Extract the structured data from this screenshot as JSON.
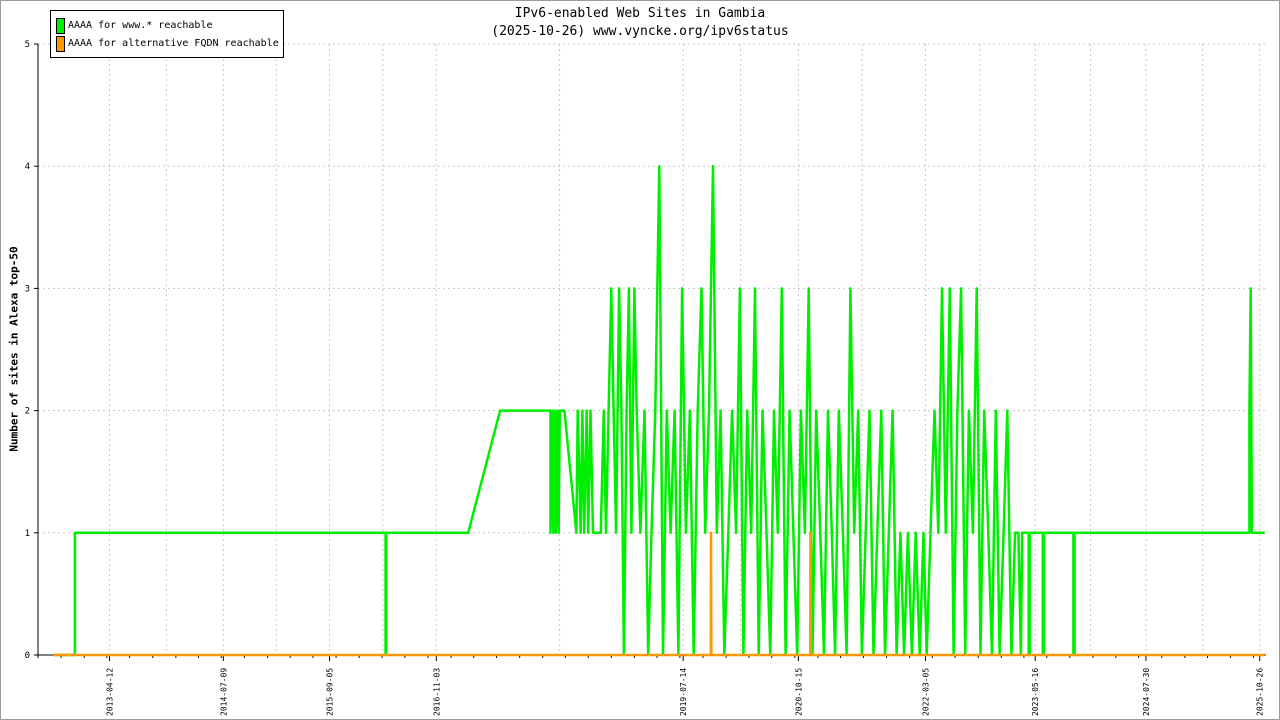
{
  "chart_data": {
    "type": "line",
    "title": "IPv6-enabled Web Sites in Gambia",
    "subtitle": "(2025-10-26) www.vyncke.org/ipv6status",
    "ylabel": "Number of sites in Alexa top-50",
    "xlabel": "",
    "ylim": [
      0,
      5
    ],
    "xlim": [
      "2012-07-01",
      "2025-11-20"
    ],
    "y_ticks": [
      0,
      1,
      2,
      3,
      4,
      5
    ],
    "x_ticks": [
      "2013-04-12",
      "2014-07-09",
      "2015-09-05",
      "2016-11-03",
      "2019-07-14",
      "2020-10-15",
      "2022-03-05",
      "2023-05-16",
      "2024-07-30",
      "2025-10-26"
    ],
    "grid": true,
    "legend_position": "top-left",
    "series": [
      {
        "name": "AAAA for www.* reachable",
        "color": "#00ee00",
        "points": [
          [
            "2012-08-30",
            0
          ],
          [
            "2012-11-25",
            0
          ],
          [
            "2012-11-25",
            1
          ],
          [
            "2016-04-15",
            1
          ],
          [
            "2016-04-15",
            0
          ],
          [
            "2016-04-18",
            0
          ],
          [
            "2016-04-18",
            1
          ],
          [
            "2017-03-10",
            1
          ],
          [
            "2017-07-15",
            2
          ],
          [
            "2018-02-01",
            2
          ],
          [
            "2018-02-01",
            1
          ],
          [
            "2018-02-10",
            2
          ],
          [
            "2018-02-12",
            1
          ],
          [
            "2018-02-18",
            2
          ],
          [
            "2018-02-22",
            1
          ],
          [
            "2018-02-28",
            2
          ],
          [
            "2018-03-05",
            1
          ],
          [
            "2018-03-10",
            2
          ],
          [
            "2018-03-28",
            2
          ],
          [
            "2018-05-15",
            1
          ],
          [
            "2018-05-20",
            2
          ],
          [
            "2018-06-01",
            1
          ],
          [
            "2018-06-08",
            2
          ],
          [
            "2018-06-15",
            1
          ],
          [
            "2018-06-25",
            2
          ],
          [
            "2018-07-01",
            1
          ],
          [
            "2018-07-10",
            2
          ],
          [
            "2018-07-20",
            1
          ],
          [
            "2018-08-20",
            1
          ],
          [
            "2018-09-01",
            2
          ],
          [
            "2018-09-10",
            1
          ],
          [
            "2018-09-20",
            2
          ],
          [
            "2018-10-01",
            3
          ],
          [
            "2018-10-10",
            2
          ],
          [
            "2018-10-20",
            1
          ],
          [
            "2018-11-01",
            3
          ],
          [
            "2018-11-10",
            2
          ],
          [
            "2018-11-20",
            0
          ],
          [
            "2018-12-01",
            2
          ],
          [
            "2018-12-10",
            3
          ],
          [
            "2018-12-20",
            1
          ],
          [
            "2019-01-01",
            3
          ],
          [
            "2019-01-10",
            2
          ],
          [
            "2019-01-25",
            1
          ],
          [
            "2019-02-10",
            2
          ],
          [
            "2019-02-25",
            0
          ],
          [
            "2019-03-10",
            1
          ],
          [
            "2019-03-25",
            2
          ],
          [
            "2019-04-10",
            4
          ],
          [
            "2019-04-25",
            0
          ],
          [
            "2019-05-10",
            2
          ],
          [
            "2019-05-25",
            1
          ],
          [
            "2019-06-10",
            2
          ],
          [
            "2019-06-25",
            0
          ],
          [
            "2019-07-10",
            3
          ],
          [
            "2019-07-25",
            1
          ],
          [
            "2019-08-10",
            2
          ],
          [
            "2019-08-25",
            0
          ],
          [
            "2019-09-10",
            2
          ],
          [
            "2019-09-25",
            3
          ],
          [
            "2019-10-10",
            1
          ],
          [
            "2019-10-25",
            2
          ],
          [
            "2019-11-10",
            4
          ],
          [
            "2019-11-25",
            1
          ],
          [
            "2019-12-10",
            2
          ],
          [
            "2019-12-25",
            0
          ],
          [
            "2020-01-10",
            1
          ],
          [
            "2020-01-25",
            2
          ],
          [
            "2020-02-10",
            1
          ],
          [
            "2020-02-25",
            3
          ],
          [
            "2020-03-10",
            0
          ],
          [
            "2020-03-25",
            2
          ],
          [
            "2020-04-10",
            1
          ],
          [
            "2020-04-25",
            3
          ],
          [
            "2020-05-10",
            0
          ],
          [
            "2020-05-25",
            2
          ],
          [
            "2020-06-10",
            1
          ],
          [
            "2020-06-25",
            0
          ],
          [
            "2020-07-10",
            2
          ],
          [
            "2020-07-25",
            1
          ],
          [
            "2020-08-10",
            3
          ],
          [
            "2020-08-25",
            0
          ],
          [
            "2020-09-10",
            2
          ],
          [
            "2020-09-25",
            1
          ],
          [
            "2020-10-10",
            0
          ],
          [
            "2020-10-25",
            2
          ],
          [
            "2020-11-10",
            1
          ],
          [
            "2020-11-25",
            3
          ],
          [
            "2020-12-10",
            0
          ],
          [
            "2020-12-25",
            2
          ],
          [
            "2021-01-10",
            1
          ],
          [
            "2021-01-25",
            0
          ],
          [
            "2021-02-10",
            2
          ],
          [
            "2021-02-25",
            1
          ],
          [
            "2021-03-10",
            0
          ],
          [
            "2021-03-25",
            2
          ],
          [
            "2021-04-10",
            1
          ],
          [
            "2021-04-25",
            0
          ],
          [
            "2021-05-10",
            3
          ],
          [
            "2021-05-25",
            1
          ],
          [
            "2021-06-10",
            2
          ],
          [
            "2021-06-25",
            0
          ],
          [
            "2021-07-10",
            1
          ],
          [
            "2021-07-25",
            2
          ],
          [
            "2021-08-10",
            0
          ],
          [
            "2021-08-25",
            1
          ],
          [
            "2021-09-10",
            2
          ],
          [
            "2021-09-25",
            0
          ],
          [
            "2021-10-10",
            1
          ],
          [
            "2021-10-25",
            2
          ],
          [
            "2021-11-10",
            0
          ],
          [
            "2021-11-25",
            1
          ],
          [
            "2021-12-10",
            0
          ],
          [
            "2021-12-25",
            1
          ],
          [
            "2022-01-10",
            0
          ],
          [
            "2022-01-25",
            1
          ],
          [
            "2022-02-10",
            0
          ],
          [
            "2022-02-25",
            1
          ],
          [
            "2022-03-10",
            0
          ],
          [
            "2022-03-25",
            1
          ],
          [
            "2022-04-10",
            2
          ],
          [
            "2022-04-25",
            1
          ],
          [
            "2022-05-10",
            3
          ],
          [
            "2022-05-25",
            1
          ],
          [
            "2022-06-10",
            3
          ],
          [
            "2022-06-25",
            0
          ],
          [
            "2022-07-10",
            2
          ],
          [
            "2022-07-25",
            3
          ],
          [
            "2022-08-10",
            0
          ],
          [
            "2022-08-25",
            2
          ],
          [
            "2022-09-10",
            1
          ],
          [
            "2022-09-25",
            3
          ],
          [
            "2022-10-10",
            0
          ],
          [
            "2022-10-25",
            2
          ],
          [
            "2022-11-10",
            1
          ],
          [
            "2022-11-25",
            0
          ],
          [
            "2022-12-10",
            2
          ],
          [
            "2022-12-25",
            0
          ],
          [
            "2023-01-10",
            1
          ],
          [
            "2023-01-25",
            2
          ],
          [
            "2023-02-10",
            0
          ],
          [
            "2023-02-25",
            1
          ],
          [
            "2023-03-10",
            1
          ],
          [
            "2023-03-20",
            0
          ],
          [
            "2023-03-25",
            1
          ],
          [
            "2023-04-20",
            1
          ],
          [
            "2023-04-20",
            0
          ],
          [
            "2023-04-25",
            0
          ],
          [
            "2023-04-25",
            1
          ],
          [
            "2023-06-15",
            1
          ],
          [
            "2023-06-15",
            0
          ],
          [
            "2023-06-20",
            0
          ],
          [
            "2023-06-20",
            1
          ],
          [
            "2023-10-15",
            1
          ],
          [
            "2023-10-15",
            0
          ],
          [
            "2023-10-20",
            0
          ],
          [
            "2023-10-20",
            1
          ],
          [
            "2025-09-15",
            1
          ],
          [
            "2025-09-15",
            2
          ],
          [
            "2025-09-20",
            3
          ],
          [
            "2025-09-25",
            1
          ],
          [
            "2025-11-15",
            1
          ]
        ]
      },
      {
        "name": "AAAA for alternative FQDN reachable",
        "color": "#ff9900",
        "points": [
          [
            "2012-08-30",
            0
          ],
          [
            "2019-11-01",
            0
          ],
          [
            "2019-11-02",
            1
          ],
          [
            "2019-11-03",
            0
          ],
          [
            "2020-12-01",
            0
          ],
          [
            "2020-12-02",
            1
          ],
          [
            "2020-12-03",
            0
          ],
          [
            "2025-11-15",
            0
          ]
        ]
      }
    ]
  }
}
